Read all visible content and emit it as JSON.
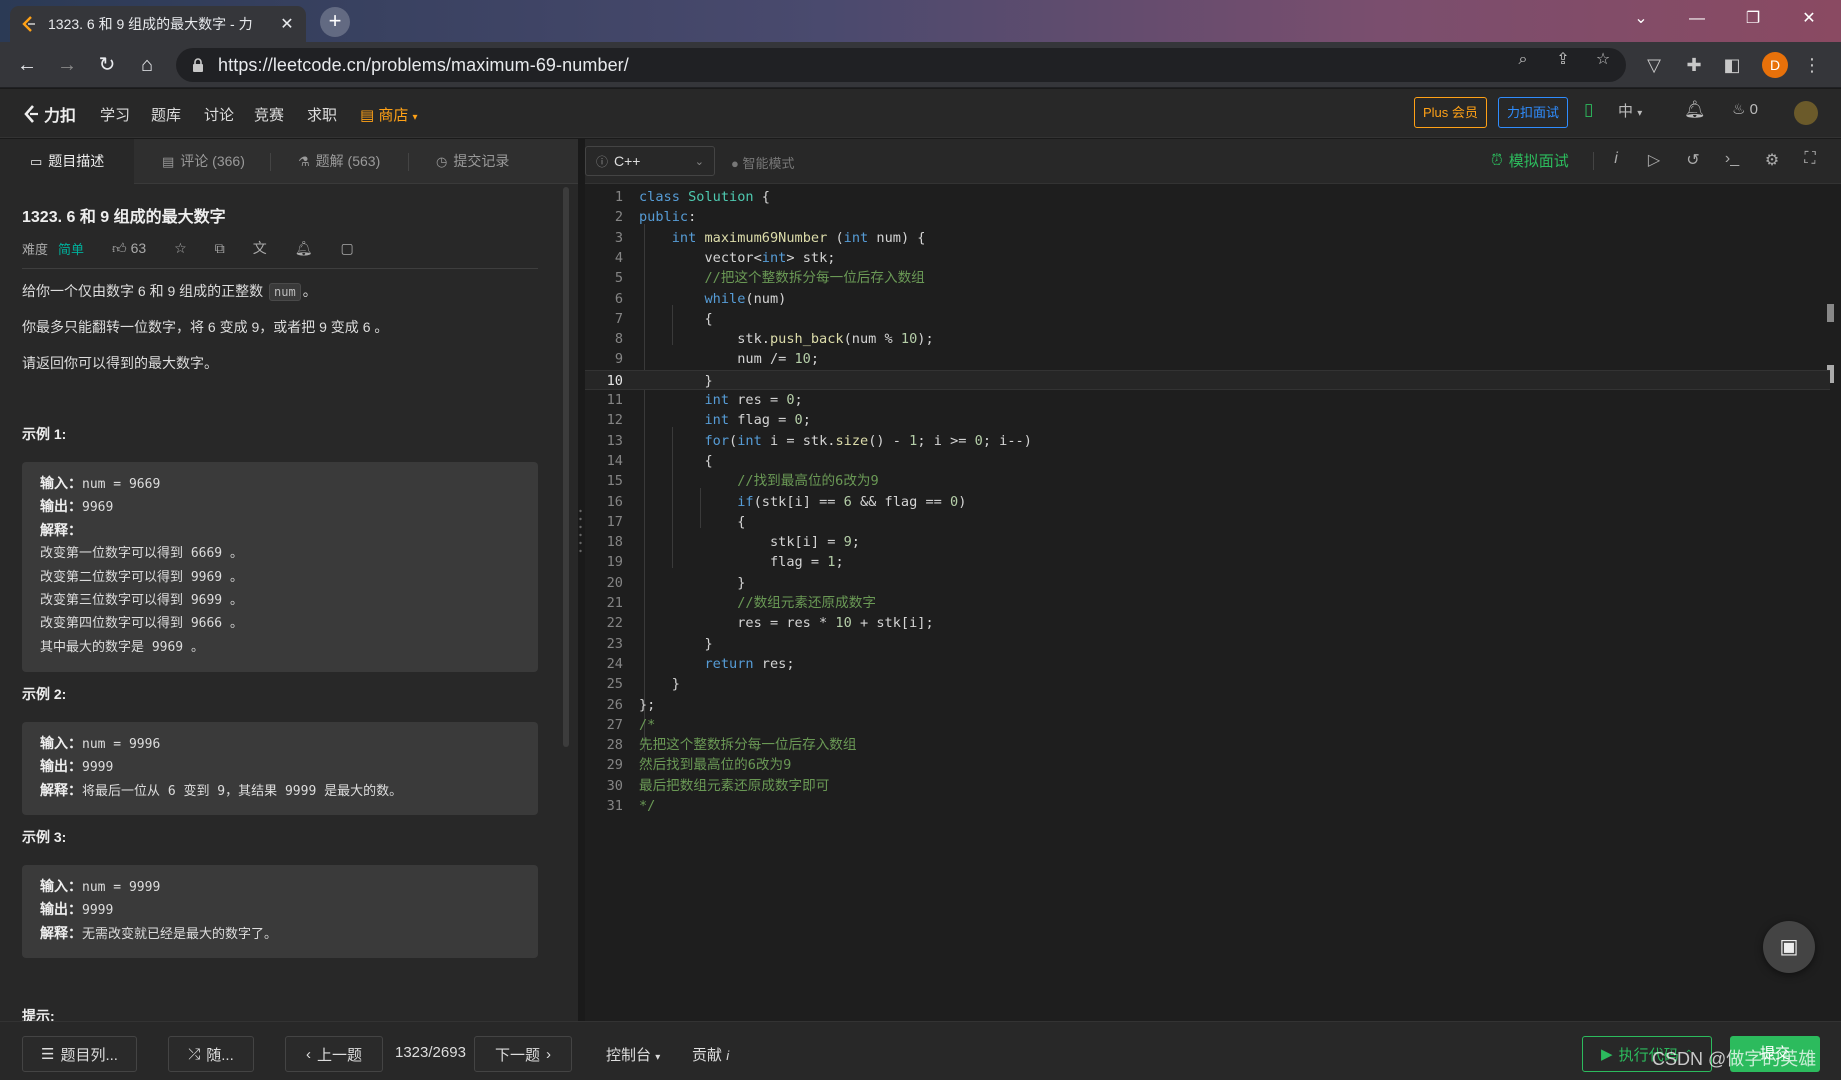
{
  "browser": {
    "tab_title": "1323. 6 和 9 组成的最大数字 - 力",
    "url": "https://leetcode.cn/problems/maximum-69-number/",
    "profile_initial": "D"
  },
  "nav": {
    "logo_text": "力扣",
    "links": [
      "学习",
      "题库",
      "讨论",
      "竞赛",
      "求职"
    ],
    "shop": "商店",
    "plus": "Plus 会员",
    "interview": "力扣面试",
    "lang": "中",
    "points": "0"
  },
  "left_tabs": {
    "description": "题目描述",
    "comments": "评论 (366)",
    "solutions": "题解 (563)",
    "submissions": "提交记录"
  },
  "problem": {
    "title": "1323. 6 和 9 组成的最大数字",
    "difficulty_label": "难度",
    "difficulty": "简单",
    "likes": "63",
    "desc1_pre": "给你一个仅由数字 6 和 9 组成的正整数",
    "desc1_code": "num",
    "desc1_post": "。",
    "desc2": "你最多只能翻转一位数字，将 6 变成 9，或者把 9 变成 6 。",
    "desc3": "请返回你可以得到的最大数字。",
    "hint_heading": "提示:",
    "examples": [
      {
        "heading": "示例 1:",
        "input_label": "输入：",
        "input": "num = 9669",
        "output_label": "输出：",
        "output": "9969",
        "explain_label": "解释：",
        "explain_lines": [
          "改变第一位数字可以得到 6669 。",
          "改变第二位数字可以得到 9969 。",
          "改变第三位数字可以得到 9699 。",
          "改变第四位数字可以得到 9666 。",
          "其中最大的数字是 9969 。"
        ]
      },
      {
        "heading": "示例 2:",
        "input_label": "输入：",
        "input": "num = 9996",
        "output_label": "输出：",
        "output": "9999",
        "explain_label": "解释：",
        "explain": "将最后一位从 6 变到 9，其结果 9999 是最大的数。"
      },
      {
        "heading": "示例 3:",
        "input_label": "输入：",
        "input": "num = 9999",
        "output_label": "输出：",
        "output": "9999",
        "explain_label": "解释：",
        "explain": "无需改变就已经是最大的数字了。"
      }
    ]
  },
  "editor": {
    "language": "C++",
    "smart_mode": "智能模式",
    "mock_interview": "模拟面试",
    "active_line": 10,
    "lines": [
      "class Solution {",
      "public:",
      "    int maximum69Number (int num) {",
      "        vector<int> stk;",
      "        //把这个整数拆分每一位后存入数组",
      "        while(num)",
      "        {",
      "            stk.push_back(num % 10);",
      "            num /= 10;",
      "        }",
      "        int res = 0;",
      "        int flag = 0;",
      "        for(int i = stk.size() - 1; i >= 0; i--)",
      "        {",
      "            //找到最高位的6改为9",
      "            if(stk[i] == 6 && flag == 0)",
      "            {",
      "                stk[i] = 9;",
      "                flag = 1;",
      "            }",
      "            //数组元素还原成数字",
      "            res = res * 10 + stk[i];",
      "        }",
      "        return res;",
      "    }",
      "};",
      "/*",
      "先把这个整数拆分每一位后存入数组",
      "然后找到最高位的6改为9",
      "最后把数组元素还原成数字即可",
      "*/"
    ]
  },
  "bottom": {
    "problem_list": "题目列...",
    "random": "随...",
    "prev": "上一题",
    "counter": "1323/2693",
    "next": "下一题",
    "console": "控制台",
    "contribute": "贡献",
    "run": "执行代码",
    "submit": "提交"
  },
  "watermark": "CSDN @做字的英雄",
  "colors": {
    "accent_green": "#2cbb5d",
    "accent_orange": "#ffa116",
    "easy": "#00af9b",
    "blue": "#2f8dff"
  }
}
